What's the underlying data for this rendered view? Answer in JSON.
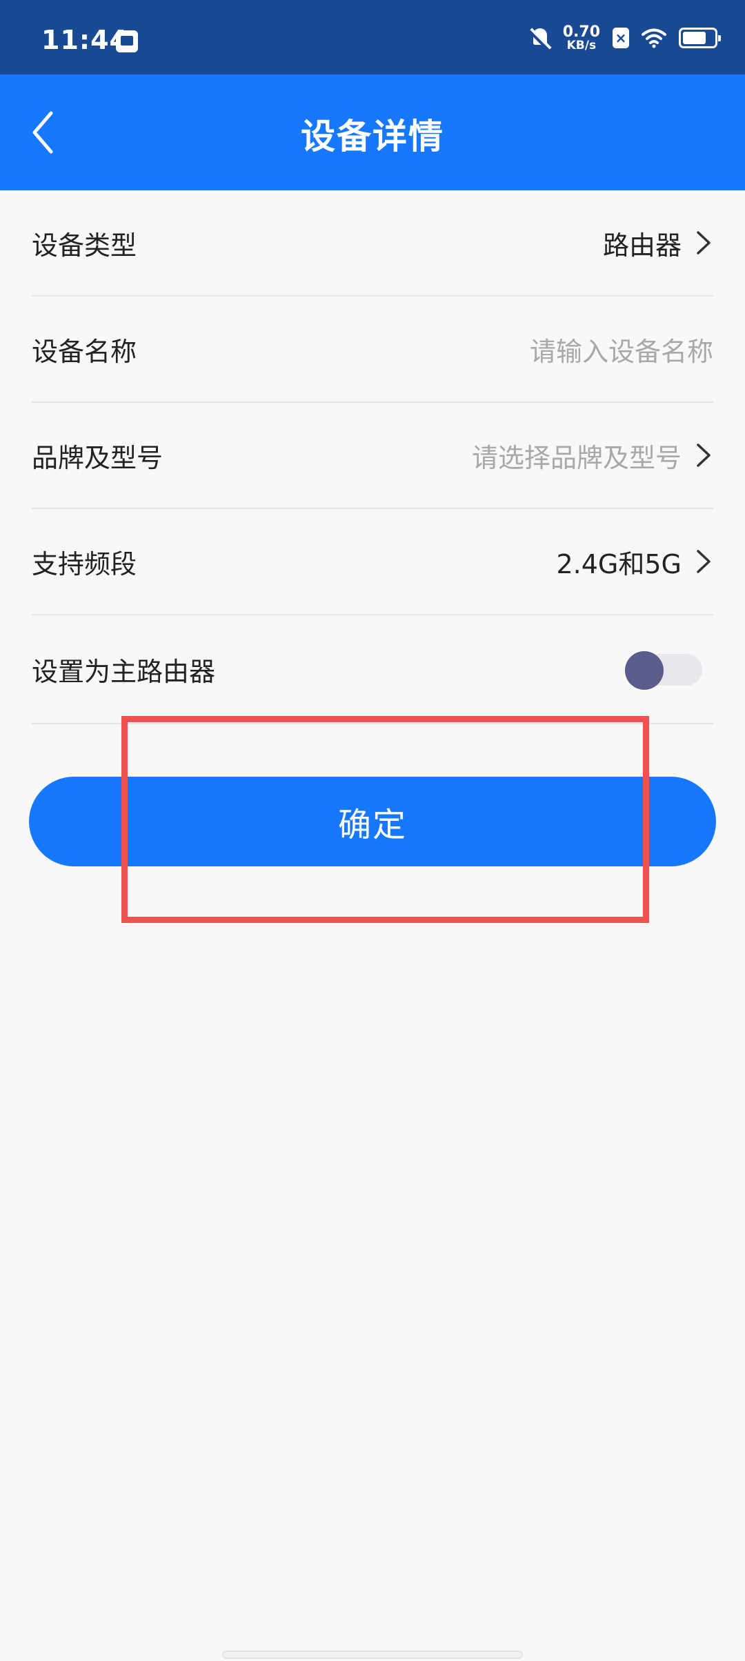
{
  "status_bar": {
    "time": "11:44",
    "net_speed_value": "0.70",
    "net_speed_unit": "KB/s",
    "sim_badge": "×",
    "icons": [
      "calendar-icon",
      "bell-muted-icon",
      "sim-x-icon",
      "wifi-icon",
      "battery-icon"
    ],
    "battery_level": 0.78
  },
  "header": {
    "title": "设备详情",
    "back_icon": "chevron-left-icon"
  },
  "form": {
    "device_type": {
      "label": "设备类型",
      "value": "路由器"
    },
    "device_name": {
      "label": "设备名称",
      "placeholder": "请输入设备名称"
    },
    "brand_model": {
      "label": "品牌及型号",
      "placeholder": "请选择品牌及型号"
    },
    "band": {
      "label": "支持频段",
      "value": "2.4G和5G"
    },
    "main_router": {
      "label": "设置为主路由器",
      "enabled": false
    }
  },
  "confirm_label": "确定",
  "colors": {
    "status_bar": "#1b4a94",
    "primary": "#1677ff",
    "background": "#f8f8f8",
    "highlight": "#ef5350",
    "toggle_knob": "#5a5d8c"
  }
}
